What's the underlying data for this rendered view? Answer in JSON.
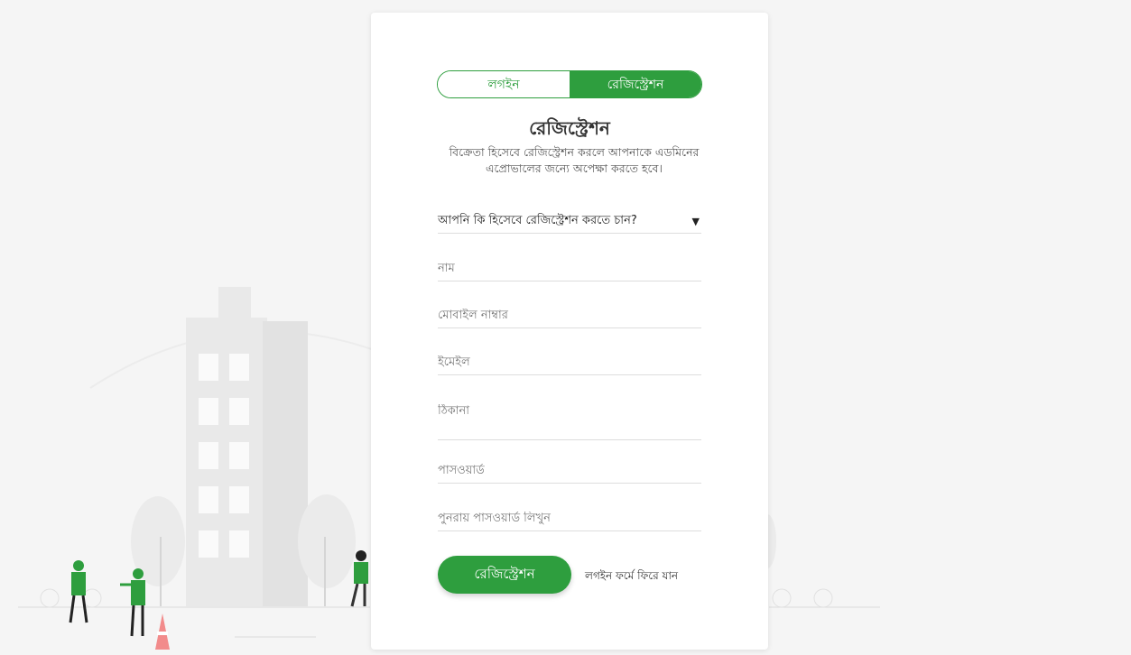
{
  "tabs": {
    "login": "লগইন",
    "register": "রেজিস্ট্রেশন"
  },
  "form": {
    "title": "রেজিস্ট্রেশন",
    "subtitle": "বিক্রেতা হিসেবে রেজিস্ট্রেশন করলে আপনাকে এডমিনের এপ্রোভালের জন্যে অপেক্ষা করতে হবে।",
    "role_select": "আপনি কি হিসেবে রেজিস্ট্রেশন করতে চান?",
    "name_placeholder": "নাম",
    "mobile_placeholder": "মোবাইল নাম্বার",
    "email_placeholder": "ইমেইল",
    "address_placeholder": "ঠিকানা",
    "password_placeholder": "পাসওয়ার্ড",
    "confirm_password_placeholder": "পুনরায় পাসওয়ার্ড লিখুন",
    "submit_label": "রেজিস্ট্রেশন",
    "back_link": "লগইন ফর্মে ফিরে যান"
  },
  "colors": {
    "accent": "#2e9e3e",
    "background": "#f5f5f5"
  },
  "icons": {
    "select": "chevron-down-icon"
  }
}
